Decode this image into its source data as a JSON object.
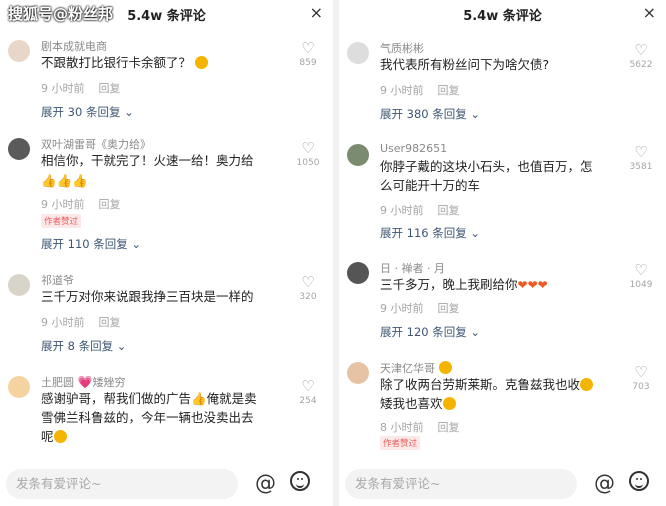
{
  "watermark": "搜狐号@粉丝邦",
  "left": {
    "header": {
      "title": "5.4w 条评论",
      "close": "×"
    },
    "comments": [
      {
        "user": "剧本成就电商",
        "text": "不跟散打比银行卡余额了？",
        "likes": "859",
        "time": "9 小时前",
        "reply": "回复",
        "expand": "展开 30 条回复"
      },
      {
        "user": "双叶湖雷哥《奥力给》",
        "text1": "相信你，干就完了！火速一给！奥力给",
        "text2": "👍👍👍",
        "likes": "1050",
        "time": "9 小时前",
        "reply": "回复",
        "badge": "作者赞过",
        "expand": "展开 110 条回复"
      },
      {
        "user": "祁道爷",
        "text": "三千万对你来说跟我挣三百块是一样的",
        "likes": "320",
        "time": "9 小时前",
        "reply": "回复",
        "expand": "展开 8 条回复"
      },
      {
        "user": "土肥圆",
        "user2": "矮矬穷",
        "text1": "感谢驴哥，帮我们做的广告👍俺就是卖",
        "text2": "雪佛兰科鲁兹的，今年一辆也没卖出去",
        "text3": "呢",
        "likes": "254"
      }
    ],
    "input_placeholder": "发条有爱评论~"
  },
  "right": {
    "header": {
      "title": "5.4w 条评论",
      "close": "×"
    },
    "comments": [
      {
        "user": "气质彬彬",
        "text": "我代表所有粉丝问下为啥欠债?",
        "likes": "5622",
        "time": "9 小时前",
        "reply": "回复",
        "expand": "展开 380 条回复"
      },
      {
        "user": "User982651",
        "text1": "你脖子戴的这块小石头，也值百万，怎",
        "text2": "么可能开十万的车",
        "likes": "3581",
        "time": "9 小时前",
        "reply": "回复",
        "expand": "展开 116 条回复"
      },
      {
        "user": "日 · 禅者 · 月",
        "text": "三千多万，晚上我刷给你",
        "likes": "1049",
        "time": "9 小时前",
        "reply": "回复",
        "expand": "展开 120 条回复"
      },
      {
        "user": "天津亿华哥",
        "text1": "除了收两台劳斯莱斯。克鲁兹我也收",
        "text2": "矮我也喜欢",
        "likes": "703",
        "time": "8 小时前",
        "reply": "回复",
        "badge": "作者赞过"
      }
    ],
    "input_placeholder": "发条有爱评论~"
  },
  "icons": {
    "heart": "heart-icon",
    "at": "at-icon",
    "emoji": "emoji-icon",
    "close": "close-icon"
  }
}
